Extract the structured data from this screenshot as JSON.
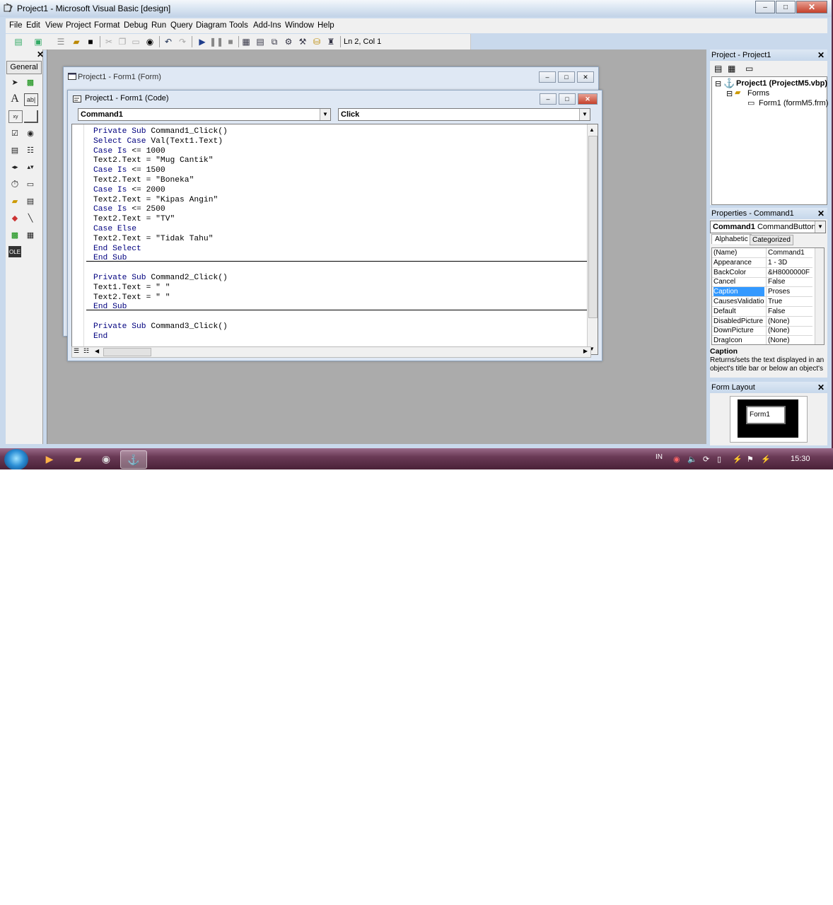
{
  "app": {
    "title": "Project1 - Microsoft Visual Basic [design]",
    "caption_buttons": [
      "–",
      "□",
      "✕"
    ]
  },
  "menu": [
    "File",
    "Edit",
    "View",
    "Project",
    "Format",
    "Debug",
    "Run",
    "Query",
    "Diagram",
    "Tools",
    "Add-Ins",
    "Window",
    "Help"
  ],
  "toolbar": {
    "icons": [
      "add-project-icon",
      "add-form-icon",
      "menu-editor-icon",
      "open-project-icon",
      "save-icon",
      "cut-icon",
      "copy-icon",
      "paste-icon",
      "find-icon",
      "undo-icon",
      "redo-icon",
      "start-icon",
      "break-icon",
      "end-icon",
      "project-explorer-icon",
      "properties-window-icon",
      "form-layout-icon",
      "object-browser-icon",
      "toolbox-icon",
      "data-view-icon",
      "component-manager-icon"
    ],
    "position_text": "Ln 2, Col 1"
  },
  "toolbox": {
    "tab_label": "General",
    "close": "✕",
    "tools": [
      "pointer-icon",
      "picturebox-icon",
      "label-icon",
      "textbox-icon",
      "frame-icon",
      "commandbutton-icon",
      "checkbox-icon",
      "optionbutton-icon",
      "combobox-icon",
      "listbox-icon",
      "hscrollbar-icon",
      "vscrollbar-icon",
      "timer-icon",
      "drivelistbox-icon",
      "dirlistbox-icon",
      "filelistbox-icon",
      "shape-icon",
      "line-icon",
      "image-icon",
      "data-icon",
      "ole-icon"
    ]
  },
  "form_window": {
    "title": "Project1 - Form1 (Form)"
  },
  "code_window": {
    "title": "Project1 - Form1 (Code)",
    "object_combo": "Command1",
    "procedure_combo": "Click",
    "lines": [
      {
        "kw": "Private Sub",
        "rest": " Command1_Click()"
      },
      {
        "kw": "Select Case",
        "rest": " Val(Text1.Text)"
      },
      {
        "kw": "Case Is",
        "rest": " <= 1000"
      },
      {
        "kw": "",
        "rest": "Text2.Text = \"Mug Cantik\""
      },
      {
        "kw": "Case Is",
        "rest": " <= 1500"
      },
      {
        "kw": "",
        "rest": "Text2.Text = \"Boneka\""
      },
      {
        "kw": "Case Is",
        "rest": " <= 2000"
      },
      {
        "kw": "",
        "rest": "Text2.Text = \"Kipas Angin\""
      },
      {
        "kw": "Case Is",
        "rest": " <= 2500"
      },
      {
        "kw": "",
        "rest": "Text2.Text = \"TV\""
      },
      {
        "kw": "Case Else",
        "rest": ""
      },
      {
        "kw": "",
        "rest": "Text2.Text = \"Tidak Tahu\""
      },
      {
        "kw": "End Select",
        "rest": ""
      },
      {
        "kw": "End Sub",
        "rest": ""
      },
      {
        "kw": "",
        "rest": ""
      },
      {
        "kw": "Private Sub",
        "rest": " Command2_Click()"
      },
      {
        "kw": "",
        "rest": "Text1.Text = \" \""
      },
      {
        "kw": "",
        "rest": "Text2.Text = \" \""
      },
      {
        "kw": "End Sub",
        "rest": ""
      },
      {
        "kw": "",
        "rest": ""
      },
      {
        "kw": "Private Sub",
        "rest": " Command3_Click()"
      },
      {
        "kw": "End",
        "rest": ""
      }
    ]
  },
  "project_explorer": {
    "title": "Project - Project1",
    "close": "✕",
    "root": "Project1 (ProjectM5.vbp)",
    "folder": "Forms",
    "item": "Form1 (formM5.frm)"
  },
  "properties": {
    "title": "Properties - Command1",
    "close": "✕",
    "object_name": "Command1",
    "object_type": "CommandButton",
    "tabs": [
      "Alphabetic",
      "Categorized"
    ],
    "rows": [
      {
        "name": "(Name)",
        "value": "Command1"
      },
      {
        "name": "Appearance",
        "value": "1 - 3D"
      },
      {
        "name": "BackColor",
        "value": "&H8000000F"
      },
      {
        "name": "Cancel",
        "value": "False"
      },
      {
        "name": "Caption",
        "value": "Proses",
        "selected": true
      },
      {
        "name": "CausesValidation",
        "value": "True"
      },
      {
        "name": "Default",
        "value": "False"
      },
      {
        "name": "DisabledPicture",
        "value": "(None)"
      },
      {
        "name": "DownPicture",
        "value": "(None)"
      },
      {
        "name": "DragIcon",
        "value": "(None)"
      }
    ],
    "desc_title": "Caption",
    "desc_text": "Returns/sets the text displayed in an object's title bar or below an object's"
  },
  "form_layout": {
    "title": "Form Layout",
    "close": "✕",
    "form_label": "Form1"
  },
  "taskbar": {
    "language": "IN",
    "clock": "15:30",
    "apps": [
      "media-player-icon",
      "explorer-icon",
      "chrome-icon",
      "vb6-icon"
    ]
  }
}
